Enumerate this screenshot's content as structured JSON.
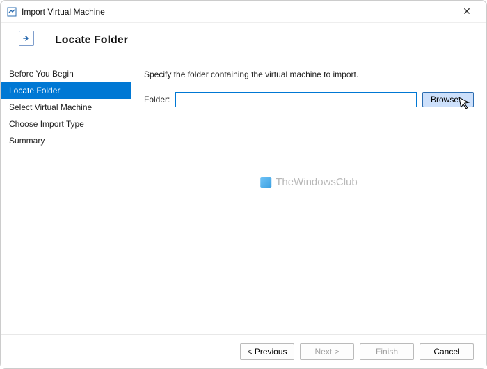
{
  "window": {
    "title": "Import Virtual Machine",
    "heading": "Locate Folder"
  },
  "sidebar": {
    "steps": [
      {
        "label": "Before You Begin",
        "active": false
      },
      {
        "label": "Locate Folder",
        "active": true
      },
      {
        "label": "Select Virtual Machine",
        "active": false
      },
      {
        "label": "Choose Import Type",
        "active": false
      },
      {
        "label": "Summary",
        "active": false
      }
    ]
  },
  "main": {
    "instruction": "Specify the folder containing the virtual machine to import.",
    "folder_label": "Folder:",
    "folder_value": "",
    "browse_label": "Browse..."
  },
  "footer": {
    "previous": "< Previous",
    "next": "Next >",
    "finish": "Finish",
    "cancel": "Cancel"
  },
  "watermark": "TheWindowsClub"
}
